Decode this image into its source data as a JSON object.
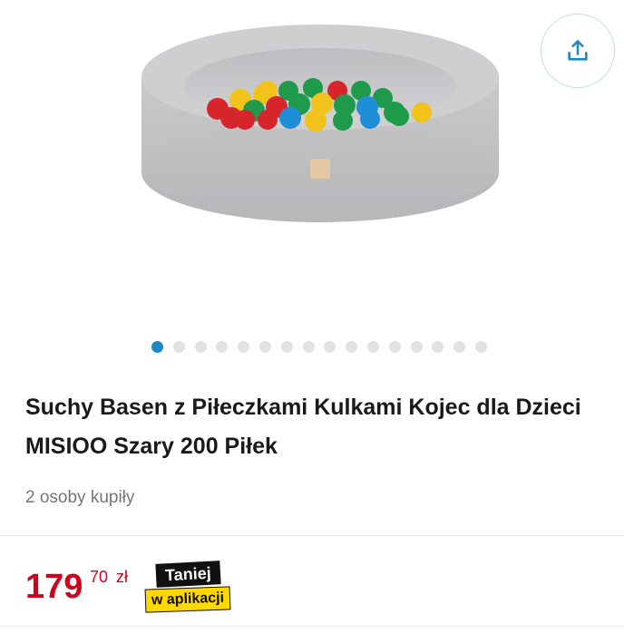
{
  "product": {
    "title_line1": "Suchy Basen z Piłeczkami Kulkami Kojec dla Dzieci",
    "title_line2": "MISIOO Szary 200 Piłek",
    "buyers": "2 osoby kupiły"
  },
  "gallery": {
    "image_count": 16,
    "active_index": 0,
    "active_color": "#1e88c7",
    "inactive_color": "#e2e2e2",
    "share_icon": "share-icon"
  },
  "price": {
    "main": "179",
    "cents": "70",
    "currency": "zł",
    "color": "#d0021b"
  },
  "promo_badge": {
    "line1": "Taniej",
    "line2": "w aplikacji"
  }
}
